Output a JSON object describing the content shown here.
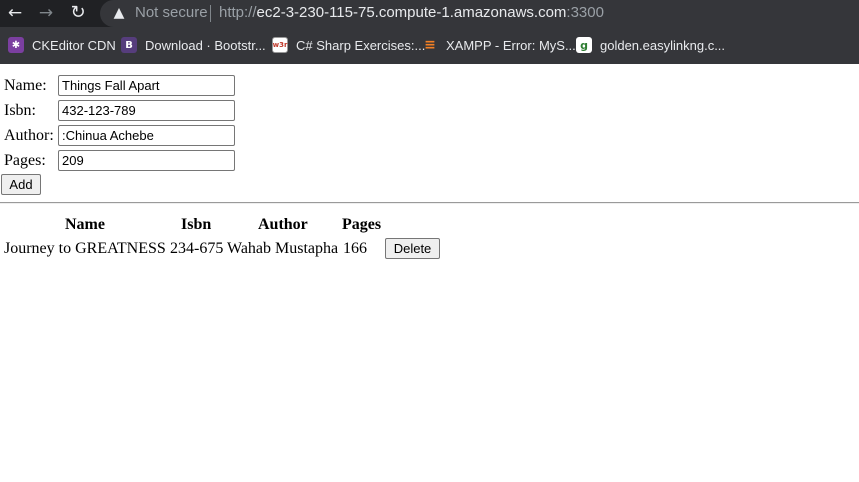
{
  "browser": {
    "security_label": "Not secure",
    "url_scheme": "http://",
    "url_host": "ec2-3-230-115-75.compute-1.amazonaws.com",
    "url_port": ":3300",
    "bookmarks": [
      {
        "label": "CKEditor CDN",
        "icon": "ckeditor-icon"
      },
      {
        "label": "Download · Bootstr...",
        "icon": "bootstrap-icon"
      },
      {
        "label": "C# Sharp Exercises:...",
        "icon": "w3resource-icon"
      },
      {
        "label": "XAMPP - Error: MyS...",
        "icon": "stackoverflow-icon"
      },
      {
        "label": "golden.easylinkng.c...",
        "icon": "golden-icon"
      }
    ]
  },
  "form": {
    "name_label": "Name:",
    "name_value": "Things Fall Apart",
    "isbn_label": "Isbn:",
    "isbn_value": "432-123-789",
    "author_label": "Author:",
    "author_value": ":Chinua Achebe",
    "pages_label": "Pages:",
    "pages_value": "209",
    "add_label": "Add"
  },
  "table": {
    "headers": [
      "Name",
      "Isbn",
      "Author",
      "Pages"
    ],
    "rows": [
      {
        "name": "Journey to GREATNESS",
        "isbn": "234-675",
        "author": "Wahab Mustapha",
        "pages": "166",
        "delete_label": "Delete"
      }
    ]
  }
}
